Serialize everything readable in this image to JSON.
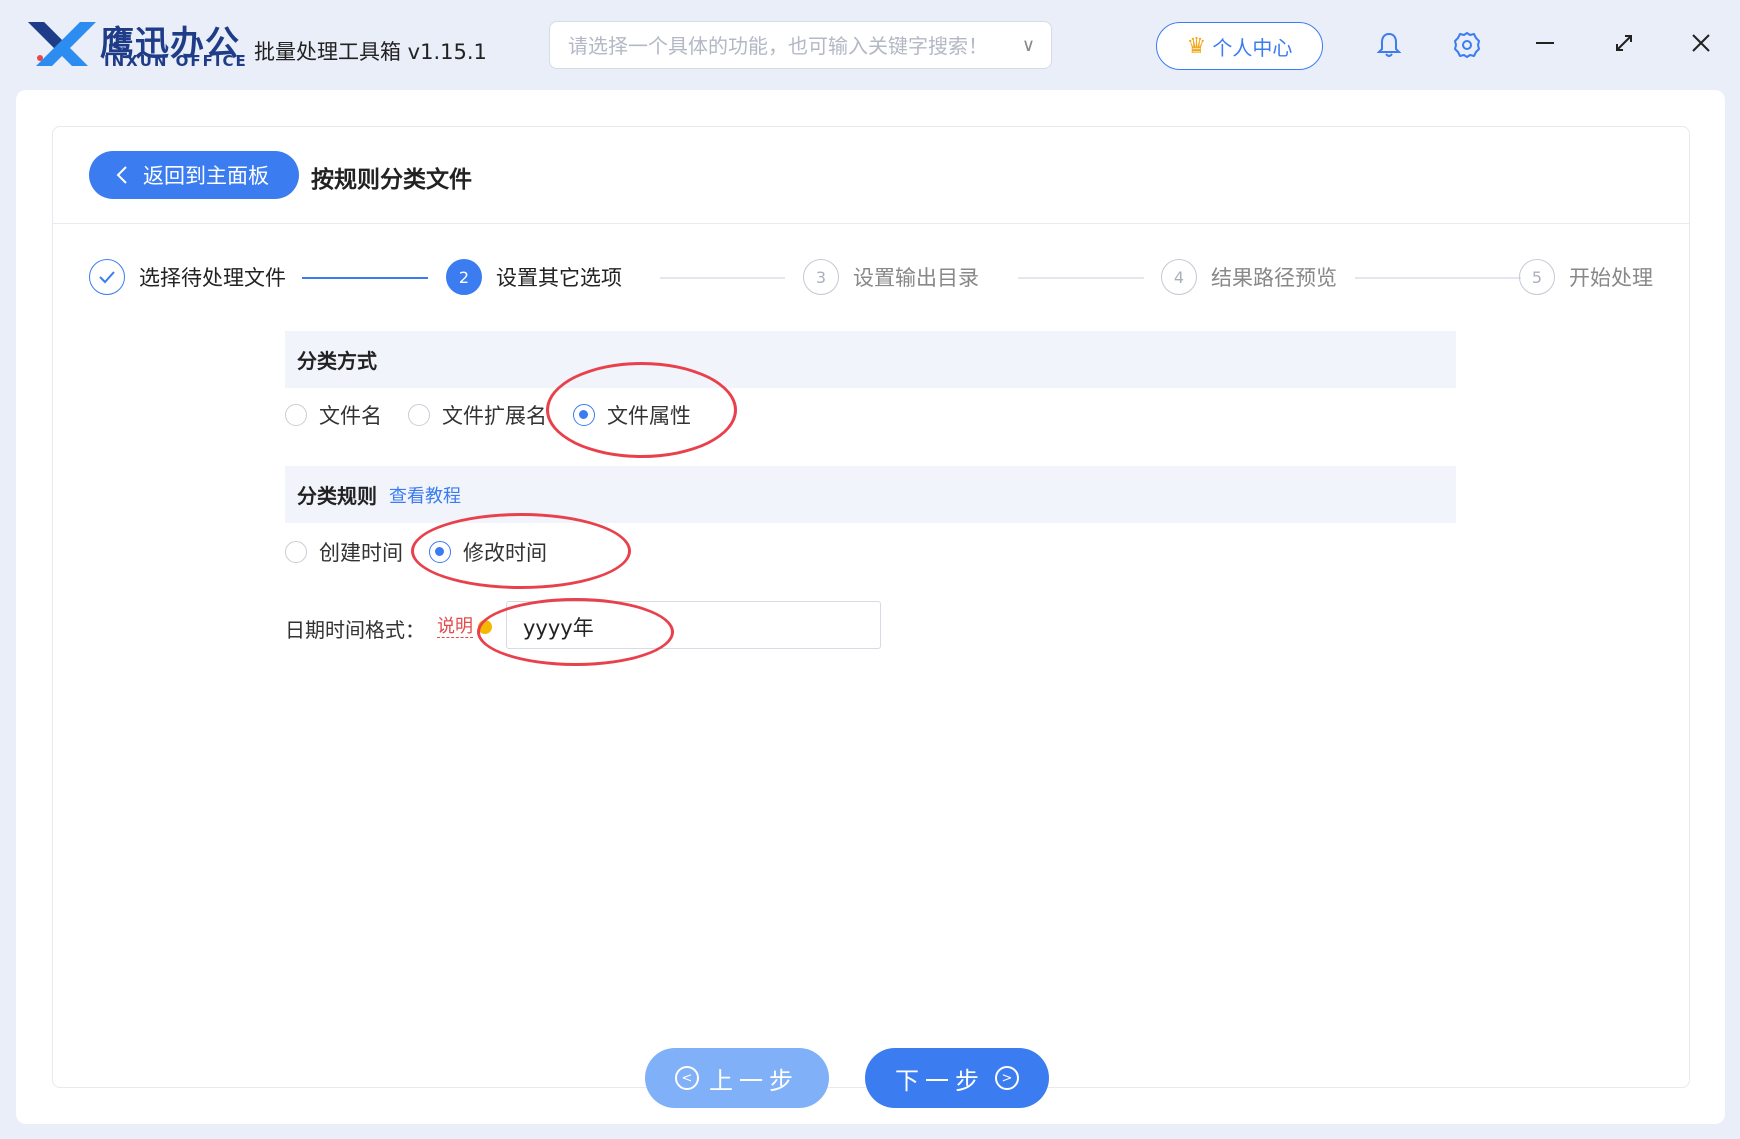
{
  "brand": {
    "name_cn": "鹰迅办公",
    "name_en": "INXUN OFFICE"
  },
  "app_title": "批量处理工具箱 v1.15.1",
  "search": {
    "placeholder": "请选择一个具体的功能，也可输入关键字搜索！"
  },
  "user_center": {
    "label": "个人中心"
  },
  "back_button": {
    "label": "返回到主面板"
  },
  "page_title": "按规则分类文件",
  "steps": [
    {
      "number": "1",
      "label": "选择待处理文件",
      "state": "done"
    },
    {
      "number": "2",
      "label": "设置其它选项",
      "state": "active"
    },
    {
      "number": "3",
      "label": "设置输出目录",
      "state": "todo"
    },
    {
      "number": "4",
      "label": "结果路径预览",
      "state": "todo"
    },
    {
      "number": "5",
      "label": "开始处理",
      "state": "todo"
    }
  ],
  "classify_method": {
    "title": "分类方式",
    "options": [
      {
        "label": "文件名",
        "checked": false
      },
      {
        "label": "文件扩展名",
        "checked": false
      },
      {
        "label": "文件属性",
        "checked": true
      }
    ]
  },
  "classify_rule": {
    "title": "分类规则",
    "tutorial_link": "查看教程",
    "options": [
      {
        "label": "创建时间",
        "checked": false
      },
      {
        "label": "修改时间",
        "checked": true
      }
    ]
  },
  "date_format": {
    "label": "日期时间格式：",
    "help": "说明",
    "value": "yyyy年"
  },
  "nav": {
    "prev": "上一步",
    "next": "下一步"
  },
  "colors": {
    "accent": "#3b7cf0",
    "annotation": "#e9414c"
  }
}
